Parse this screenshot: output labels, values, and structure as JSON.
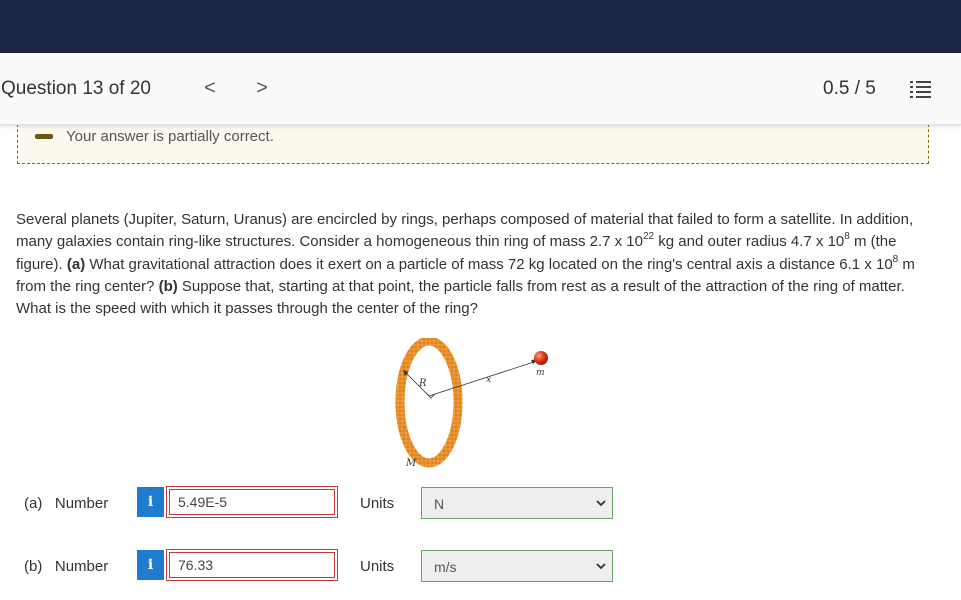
{
  "header": {
    "question_title": "Question 13 of 20",
    "prev_arrow": "<",
    "next_arrow": ">",
    "score": "0.5 / 5",
    "list_icon": "list-icon"
  },
  "feedback": {
    "text": "Your answer is partially correct.",
    "color": "#8a6b14"
  },
  "question": {
    "text_1": "Several planets (Jupiter, Saturn, Uranus) are encircled by rings, perhaps composed of material that failed to form a satellite. In addition, many galaxies contain ring-like structures. Consider a homogeneous thin ring of mass 2.7 x 10",
    "exp_1": "22",
    "text_2": " kg and outer radius 4.7 x 10",
    "exp_2": "8",
    "text_3": " m (the figure). ",
    "part_a_label": "(a)",
    "text_4": " What gravitational attraction does it exert on a particle of mass 72 kg located on the ring's central axis a distance 6.1 x 10",
    "exp_3": "8",
    "text_5": " m from the ring center? ",
    "part_b_label": "(b)",
    "text_6": " Suppose that, starting at that point, the particle falls from rest as a result of the attraction of the ring of matter. What is the speed with which it passes through the center of the ring?"
  },
  "figure": {
    "label_R": "R",
    "label_x": "x",
    "label_m": "m",
    "label_M": "M"
  },
  "answers": [
    {
      "part": "(a)",
      "number_label": "Number",
      "info": "i",
      "value": "5.49E-5",
      "units_label": "Units",
      "unit": "N"
    },
    {
      "part": "(b)",
      "number_label": "Number",
      "info": "i",
      "value": "76.33",
      "units_label": "Units",
      "unit": "m/s"
    }
  ],
  "colors": {
    "topbar": "#1b2544",
    "info_button": "#1f7ccf",
    "incorrect_border": "#c0393b",
    "correct_border": "#6aa36a",
    "ring": "#e8912c",
    "particle": "#d83a1e"
  }
}
